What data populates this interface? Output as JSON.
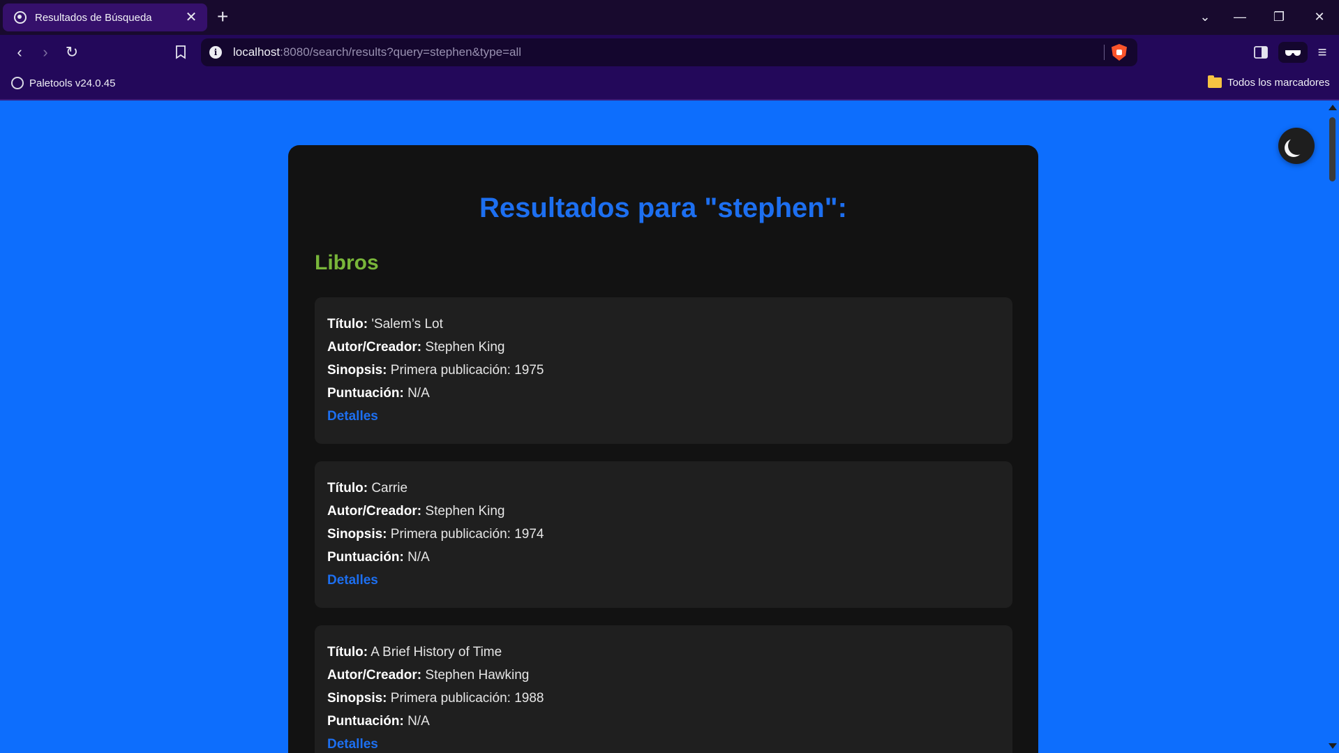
{
  "browser": {
    "tab_title": "Resultados de Búsqueda",
    "url_host": "localhost",
    "url_rest": ":8080/search/results?query=stephen&type=all",
    "bookmarks": {
      "left_item": "Paletools v24.0.45",
      "right_item": "Todos los marcadores"
    }
  },
  "page": {
    "heading": "Resultados para \"stephen\":",
    "section_title": "Libros",
    "labels": {
      "title": "Título:",
      "author": "Autor/Creador:",
      "synopsis": "Sinopsis:",
      "score": "Puntuación:",
      "details": "Detalles"
    },
    "results": [
      {
        "title": "'Salem’s Lot",
        "author": "Stephen King",
        "synopsis": "Primera publicación: 1975",
        "score": "N/A"
      },
      {
        "title": "Carrie",
        "author": "Stephen King",
        "synopsis": "Primera publicación: 1974",
        "score": "N/A"
      },
      {
        "title": "A Brief History of Time",
        "author": "Stephen Hawking",
        "synopsis": "Primera publicación: 1988",
        "score": "N/A"
      }
    ]
  },
  "colors": {
    "page_background": "#0d6efd",
    "panel_background": "#121212",
    "card_background": "#1f1f1f",
    "heading": "#1d6ff0",
    "section_title": "#79b63a",
    "link": "#1d6ff0"
  },
  "icons": {
    "theme_toggle": "moon-icon"
  }
}
